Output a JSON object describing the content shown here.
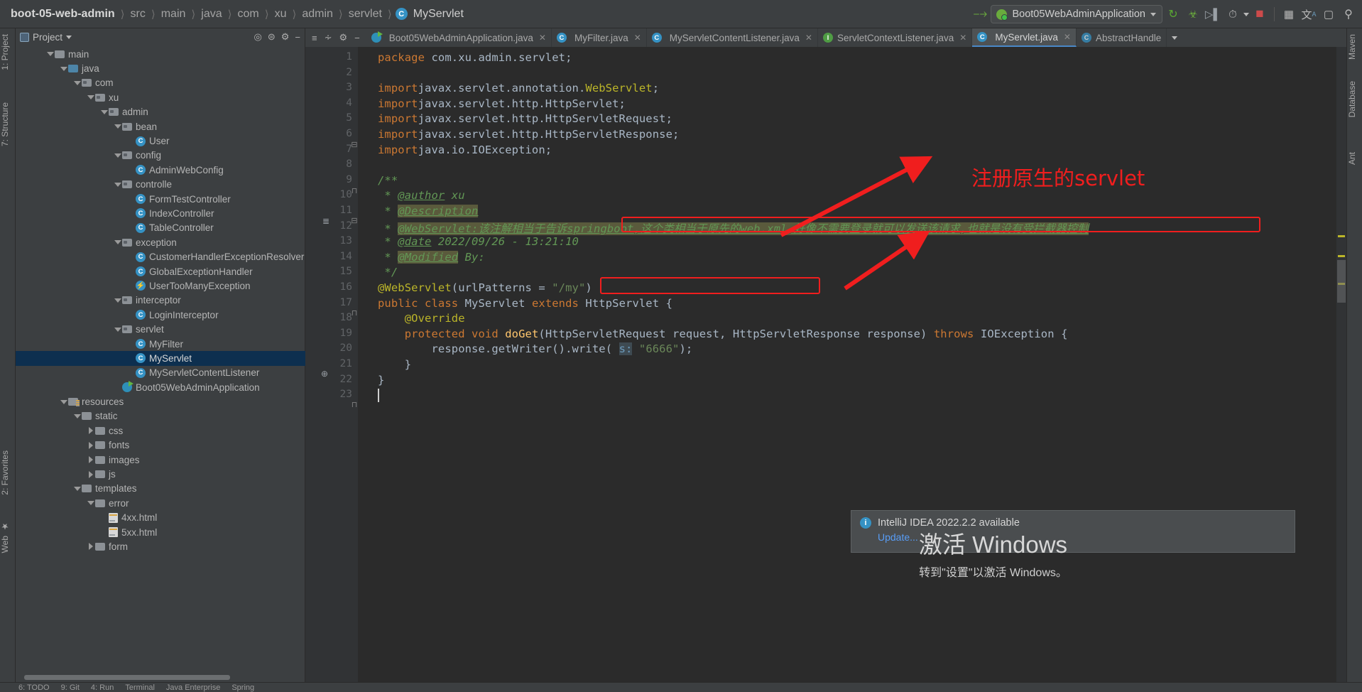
{
  "window": {
    "breadcrumb": [
      {
        "label": "boot-05-web-admin",
        "type": "root"
      },
      {
        "label": "src",
        "type": "dir"
      },
      {
        "label": "main",
        "type": "dir"
      },
      {
        "label": "java",
        "type": "dir"
      },
      {
        "label": "com",
        "type": "dir"
      },
      {
        "label": "xu",
        "type": "dir"
      },
      {
        "label": "admin",
        "type": "dir"
      },
      {
        "label": "servlet",
        "type": "dir"
      },
      {
        "label": "MyServlet",
        "type": "class"
      }
    ]
  },
  "toolbar": {
    "hammer_icon": "build-icon",
    "run_config": "Boot05WebAdminApplication",
    "run_config_caret": "chevron-down-icon",
    "icons": [
      "rerun-icon",
      "debug-icon",
      "run-with-coverage-icon",
      "profiler-icon",
      "stop-icon",
      "services-icon",
      "translate-icon",
      "terminal-icon",
      "search-icon"
    ]
  },
  "left_tool_strip": [
    {
      "label": "1: Project",
      "name": "tool-window-project"
    },
    {
      "label": "7: Structure",
      "name": "tool-window-structure"
    },
    {
      "label": "2: Favorites",
      "name": "tool-window-favorites"
    },
    {
      "label": "Web",
      "name": "tool-window-web"
    }
  ],
  "right_tool_strip": [
    {
      "label": "Maven",
      "name": "tool-window-maven"
    },
    {
      "label": "Database",
      "name": "tool-window-database"
    },
    {
      "label": "Ant",
      "name": "tool-window-ant"
    }
  ],
  "project_panel": {
    "title": "Project",
    "caret": "chevron-down-icon",
    "tree": [
      {
        "label": "main",
        "indent": 2,
        "arrow": "down",
        "icon": "folder",
        "selected": false
      },
      {
        "label": "java",
        "indent": 3,
        "arrow": "down",
        "icon": "folder-src",
        "selected": false
      },
      {
        "label": "com",
        "indent": 4,
        "arrow": "down",
        "icon": "folder-pkg",
        "selected": false
      },
      {
        "label": "xu",
        "indent": 5,
        "arrow": "down",
        "icon": "folder-pkg",
        "selected": false
      },
      {
        "label": "admin",
        "indent": 6,
        "arrow": "down",
        "icon": "folder-pkg",
        "selected": false
      },
      {
        "label": "bean",
        "indent": 7,
        "arrow": "down",
        "icon": "folder-pkg",
        "selected": false
      },
      {
        "label": "User",
        "indent": 8,
        "arrow": "none",
        "icon": "class",
        "selected": false
      },
      {
        "label": "config",
        "indent": 7,
        "arrow": "down",
        "icon": "folder-pkg",
        "selected": false
      },
      {
        "label": "AdminWebConfig",
        "indent": 8,
        "arrow": "none",
        "icon": "class",
        "selected": false
      },
      {
        "label": "controlle",
        "indent": 7,
        "arrow": "down",
        "icon": "folder-pkg",
        "selected": false
      },
      {
        "label": "FormTestController",
        "indent": 8,
        "arrow": "none",
        "icon": "class",
        "selected": false
      },
      {
        "label": "IndexController",
        "indent": 8,
        "arrow": "none",
        "icon": "class",
        "selected": false
      },
      {
        "label": "TableController",
        "indent": 8,
        "arrow": "none",
        "icon": "class",
        "selected": false
      },
      {
        "label": "exception",
        "indent": 7,
        "arrow": "down",
        "icon": "folder-pkg",
        "selected": false
      },
      {
        "label": "CustomerHandlerExceptionResolver",
        "indent": 8,
        "arrow": "none",
        "icon": "class",
        "selected": false
      },
      {
        "label": "GlobalExceptionHandler",
        "indent": 8,
        "arrow": "none",
        "icon": "class",
        "selected": false
      },
      {
        "label": "UserTooManyException",
        "indent": 8,
        "arrow": "none",
        "icon": "exception",
        "selected": false
      },
      {
        "label": "interceptor",
        "indent": 7,
        "arrow": "down",
        "icon": "folder-pkg",
        "selected": false
      },
      {
        "label": "LoginInterceptor",
        "indent": 8,
        "arrow": "none",
        "icon": "class",
        "selected": false
      },
      {
        "label": "servlet",
        "indent": 7,
        "arrow": "down",
        "icon": "folder-pkg",
        "selected": false
      },
      {
        "label": "MyFilter",
        "indent": 8,
        "arrow": "none",
        "icon": "class",
        "selected": false
      },
      {
        "label": "MyServlet",
        "indent": 8,
        "arrow": "none",
        "icon": "class",
        "selected": true
      },
      {
        "label": "MyServletContentListener",
        "indent": 8,
        "arrow": "none",
        "icon": "class",
        "selected": false
      },
      {
        "label": "Boot05WebAdminApplication",
        "indent": 7,
        "arrow": "none",
        "icon": "spring",
        "selected": false
      },
      {
        "label": "resources",
        "indent": 3,
        "arrow": "down",
        "icon": "folder-res",
        "selected": false
      },
      {
        "label": "static",
        "indent": 4,
        "arrow": "down",
        "icon": "folder",
        "selected": false
      },
      {
        "label": "css",
        "indent": 5,
        "arrow": "right",
        "icon": "folder",
        "selected": false
      },
      {
        "label": "fonts",
        "indent": 5,
        "arrow": "right",
        "icon": "folder",
        "selected": false
      },
      {
        "label": "images",
        "indent": 5,
        "arrow": "right",
        "icon": "folder",
        "selected": false
      },
      {
        "label": "js",
        "indent": 5,
        "arrow": "right",
        "icon": "folder",
        "selected": false
      },
      {
        "label": "templates",
        "indent": 4,
        "arrow": "down",
        "icon": "folder",
        "selected": false
      },
      {
        "label": "error",
        "indent": 5,
        "arrow": "down",
        "icon": "folder",
        "selected": false
      },
      {
        "label": "4xx.html",
        "indent": 6,
        "arrow": "none",
        "icon": "html",
        "selected": false
      },
      {
        "label": "5xx.html",
        "indent": 6,
        "arrow": "none",
        "icon": "html",
        "selected": false
      },
      {
        "label": "form",
        "indent": 5,
        "arrow": "right",
        "icon": "folder",
        "selected": false
      }
    ]
  },
  "editor": {
    "tabs": [
      {
        "label": "Boot05WebAdminApplication.java",
        "icon": "spring",
        "active": false,
        "closable": true
      },
      {
        "label": "MyFilter.java",
        "icon": "class",
        "active": false,
        "closable": true
      },
      {
        "label": "MyServletContentListener.java",
        "icon": "class",
        "active": false,
        "closable": true
      },
      {
        "label": "ServletContextListener.java",
        "icon": "interface-lib",
        "active": false,
        "closable": true
      },
      {
        "label": "MyServlet.java",
        "icon": "class",
        "active": true,
        "closable": true
      },
      {
        "label": "AbstractHandle",
        "icon": "class-readonly",
        "active": false,
        "closable": false
      }
    ],
    "tab_overflow": "chevron-down-icon",
    "code_lines": [
      {
        "n": 1,
        "text": "package com.xu.admin.servlet;"
      },
      {
        "n": 2,
        "text": ""
      },
      {
        "n": 3,
        "text": "import javax.servlet.annotation.WebServlet;"
      },
      {
        "n": 4,
        "text": "import javax.servlet.http.HttpServlet;"
      },
      {
        "n": 5,
        "text": "import javax.servlet.http.HttpServletRequest;"
      },
      {
        "n": 6,
        "text": "import javax.servlet.http.HttpServletResponse;"
      },
      {
        "n": 7,
        "text": "import java.io.IOException;"
      },
      {
        "n": 8,
        "text": ""
      },
      {
        "n": 9,
        "text": "/**"
      },
      {
        "n": 10,
        "text": " * @author xu"
      },
      {
        "n": 11,
        "text": " * @Description"
      },
      {
        "n": 12,
        "text": " * @WebServlet:该注解相当于告诉springboot,这个类相当于原先的web.xml,好像不需要登录就可以发送该请求,也就是没有受拦截器控制"
      },
      {
        "n": 13,
        "text": " * @date 2022/09/26 - 13:21:10"
      },
      {
        "n": 14,
        "text": " * @Modified By:"
      },
      {
        "n": 15,
        "text": " */"
      },
      {
        "n": 16,
        "text": "@WebServlet(urlPatterns = \"/my\")"
      },
      {
        "n": 17,
        "text": "public class MyServlet extends HttpServlet {"
      },
      {
        "n": 18,
        "text": "    @Override"
      },
      {
        "n": 19,
        "text": "    protected void doGet(HttpServletRequest request, HttpServletResponse response) throws IOException {"
      },
      {
        "n": 20,
        "text": "        response.getWriter().write( s: \"6666\");"
      },
      {
        "n": 21,
        "text": "    }"
      },
      {
        "n": 22,
        "text": "}"
      },
      {
        "n": 23,
        "text": ""
      }
    ],
    "param_hint": "s:"
  },
  "annotations": {
    "red_label": "注册原生的servlet",
    "red_color": "#f01e1e",
    "boxes": [
      "javadoc-webservlet-line",
      "webservlet-annotation-line"
    ],
    "arrows": 2
  },
  "notification": {
    "icon": "info-icon",
    "title": "IntelliJ IDEA 2022.2.2 available",
    "action": "Update..."
  },
  "watermark": {
    "line1": "激活 Windows",
    "line2": "转到\"设置\"以激活 Windows。"
  },
  "status_bar": {
    "left": "6: TODO",
    "items": [
      "6: TODO",
      "9: Git",
      "4: Run",
      "Terminal",
      "Java Enterprise",
      "Spring"
    ]
  },
  "colors": {
    "editor_bg": "#2b2b2b",
    "panel_bg": "#3c3f41",
    "selection": "#0d2f4f",
    "accent": "#3592c4",
    "keyword": "#cc7832",
    "string": "#6a8759",
    "annotation": "#bbb529",
    "comment": "#629755",
    "red": "#f01e1e"
  }
}
